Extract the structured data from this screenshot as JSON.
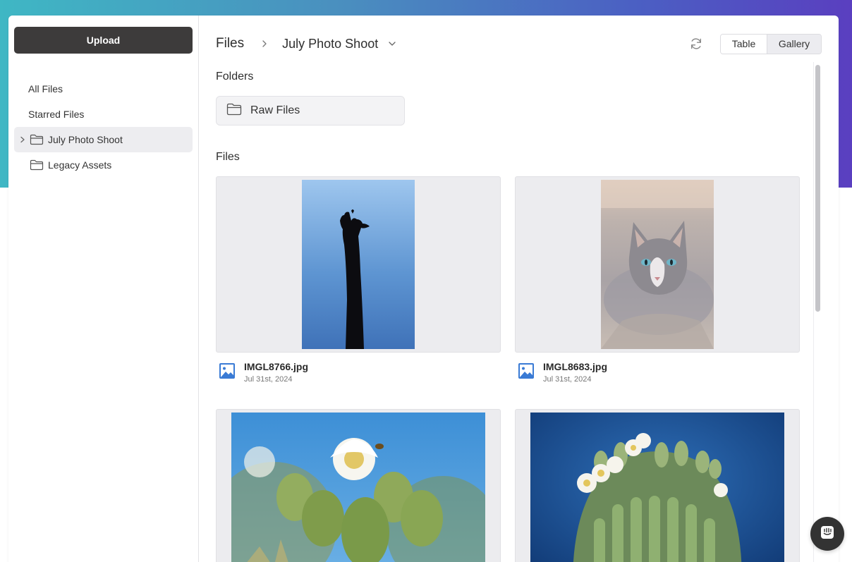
{
  "sidebar": {
    "upload_label": "Upload",
    "items": [
      {
        "label": "All Files"
      },
      {
        "label": "Starred Files"
      },
      {
        "label": "July Photo Shoot",
        "icon": "folder-icon",
        "expand_icon": "chevron-right-icon",
        "active": true
      },
      {
        "label": "Legacy Assets",
        "icon": "folder-icon"
      }
    ]
  },
  "header": {
    "breadcrumb_root": "Files",
    "breadcrumb_current": "July Photo Shoot",
    "view_options": [
      "Table",
      "Gallery"
    ],
    "selected_view": "Gallery"
  },
  "folders": {
    "title": "Folders",
    "items": [
      {
        "name": "Raw Files",
        "icon": "folder-icon"
      }
    ]
  },
  "files": {
    "title": "Files",
    "items": [
      {
        "name": "IMGL8766.jpg",
        "date": "Jul 31st, 2024",
        "icon": "image-file-icon",
        "subject": "saguaro cactus silhouette against blue sky"
      },
      {
        "name": "IMGL8683.jpg",
        "date": "Jul 31st, 2024",
        "icon": "image-file-icon",
        "subject": "grey tabby cat lying on gravel"
      },
      {
        "name": "",
        "date": "",
        "subject": "saguaro blossoms with a bee"
      },
      {
        "name": "",
        "date": "",
        "subject": "saguaro cactus crown of white flowers"
      }
    ]
  },
  "colors": {
    "accent_dark": "#3d3b3b",
    "active_bg": "#ededf0",
    "file_icon": "#3a7bd5",
    "gradient": [
      "#3fb7c4",
      "#5a3fc0"
    ]
  }
}
